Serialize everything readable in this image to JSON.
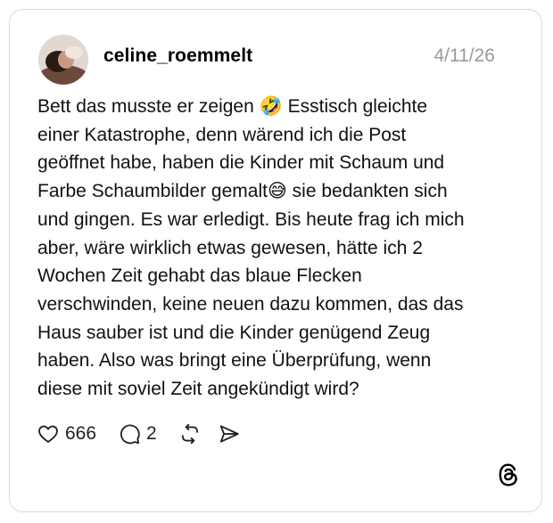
{
  "post": {
    "username": "celine_roemmelt",
    "date": "4/11/26",
    "text_lines": [
      "Bett das musste er zeigen 🤣 Esstisch gleichte",
      "einer Katastrophe, denn wärend ich die Post",
      "geöffnet habe, haben die Kinder mit Schaum und",
      "Farbe Schaumbilder gemalt😅 sie bedankten sich",
      "und gingen. Es war erledigt. Bis heute frag ich mich",
      "aber, wäre wirklich etwas gewesen, hätte ich 2",
      "Wochen Zeit gehabt das blaue Flecken",
      "verschwinden, keine neuen dazu kommen, das das",
      "Haus sauber ist und die Kinder genügend Zeug",
      "haben. Also was bringt eine Überprüfung, wenn",
      "diese mit soviel Zeit angekündigt wird?"
    ],
    "like_count": "666",
    "reply_count": "2"
  },
  "icons": {
    "avatar": "profile-photo",
    "like": "heart-icon",
    "reply": "speech-bubble-icon",
    "repost": "repost-icon",
    "share": "send-icon",
    "brand": "threads-logo-icon"
  },
  "colors": {
    "border": "#d9d9d9",
    "date_text": "#999999",
    "text": "#111111"
  }
}
